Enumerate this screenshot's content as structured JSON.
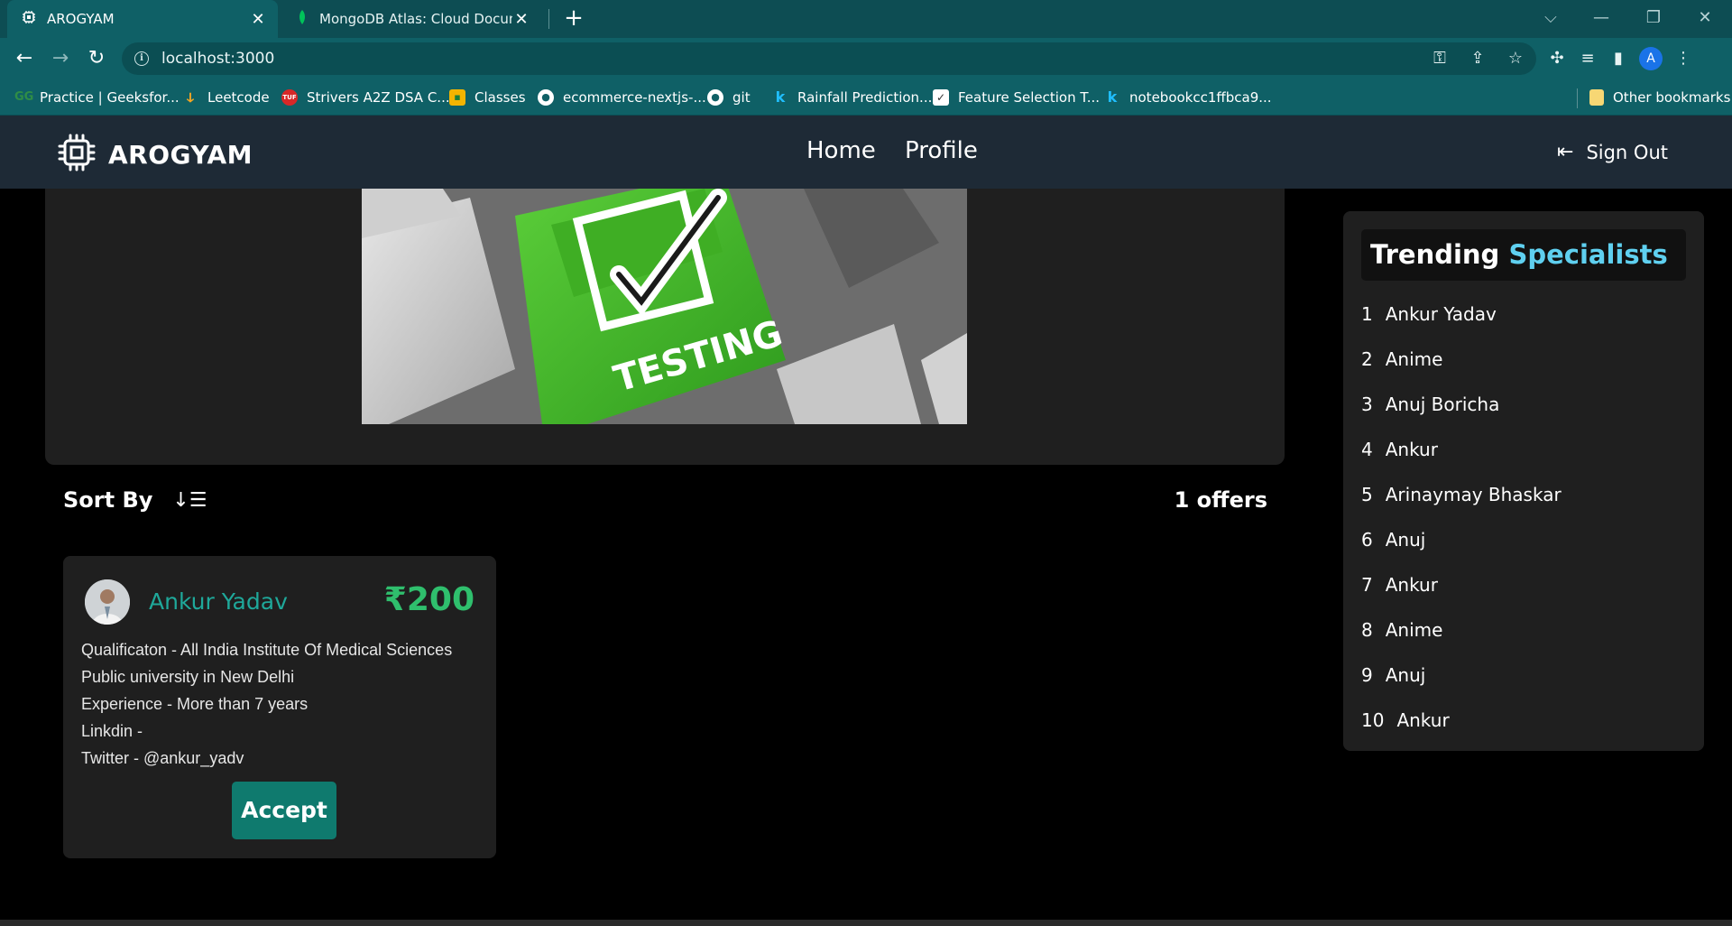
{
  "browser": {
    "tabs": [
      {
        "title": "AROGYAM",
        "active": true
      },
      {
        "title": "MongoDB Atlas: Cloud Documen",
        "active": false
      }
    ],
    "url": "localhost:3000",
    "profile_initial": "A",
    "bookmarks": [
      {
        "label": "Practice | Geeksfor..."
      },
      {
        "label": "Leetcode"
      },
      {
        "label": "Strivers A2Z DSA C..."
      },
      {
        "label": "Classes"
      },
      {
        "label": "ecommerce-nextjs-..."
      },
      {
        "label": "git"
      },
      {
        "label": "Rainfall Prediction..."
      },
      {
        "label": "Feature Selection T..."
      },
      {
        "label": "notebookcc1ffbca9..."
      }
    ],
    "other_bookmarks": "Other bookmarks"
  },
  "app": {
    "brand": "AROGYAM",
    "nav": {
      "home": "Home",
      "profile": "Profile",
      "signout": "Sign Out"
    },
    "banner_text": "TESTING",
    "sort_label": "Sort By",
    "offers_count": "1 offers",
    "offer": {
      "name": "Ankur Yadav",
      "price": "₹200",
      "qualification": "Qualificaton - All India Institute Of Medical Sciences",
      "qualification_cont": "Public university in New Delhi",
      "experience": "Experience - More than 7 years",
      "linkedin": "Linkdin -",
      "twitter": "Twitter - @ankur_yadv",
      "accept_label": "Accept"
    },
    "trending": {
      "title_main": "Trending",
      "title_accent": "Specialists",
      "items": [
        {
          "rank": "1",
          "name": "Ankur Yadav"
        },
        {
          "rank": "2",
          "name": "Anime"
        },
        {
          "rank": "3",
          "name": "Anuj Boricha"
        },
        {
          "rank": "4",
          "name": "Ankur"
        },
        {
          "rank": "5",
          "name": "Arinaymay Bhaskar"
        },
        {
          "rank": "6",
          "name": "Anuj"
        },
        {
          "rank": "7",
          "name": "Ankur"
        },
        {
          "rank": "8",
          "name": "Anime"
        },
        {
          "rank": "9",
          "name": "Anuj"
        },
        {
          "rank": "10",
          "name": "Ankur"
        }
      ]
    }
  },
  "colors": {
    "browser_frame": "#0f6066",
    "app_nav": "#1e2a36",
    "card": "#1f1f1f",
    "accent_teal": "#1fa89a",
    "price_green": "#2fbf6d",
    "accent_cyan": "#5fd0f0",
    "button": "#0f7a6e"
  }
}
